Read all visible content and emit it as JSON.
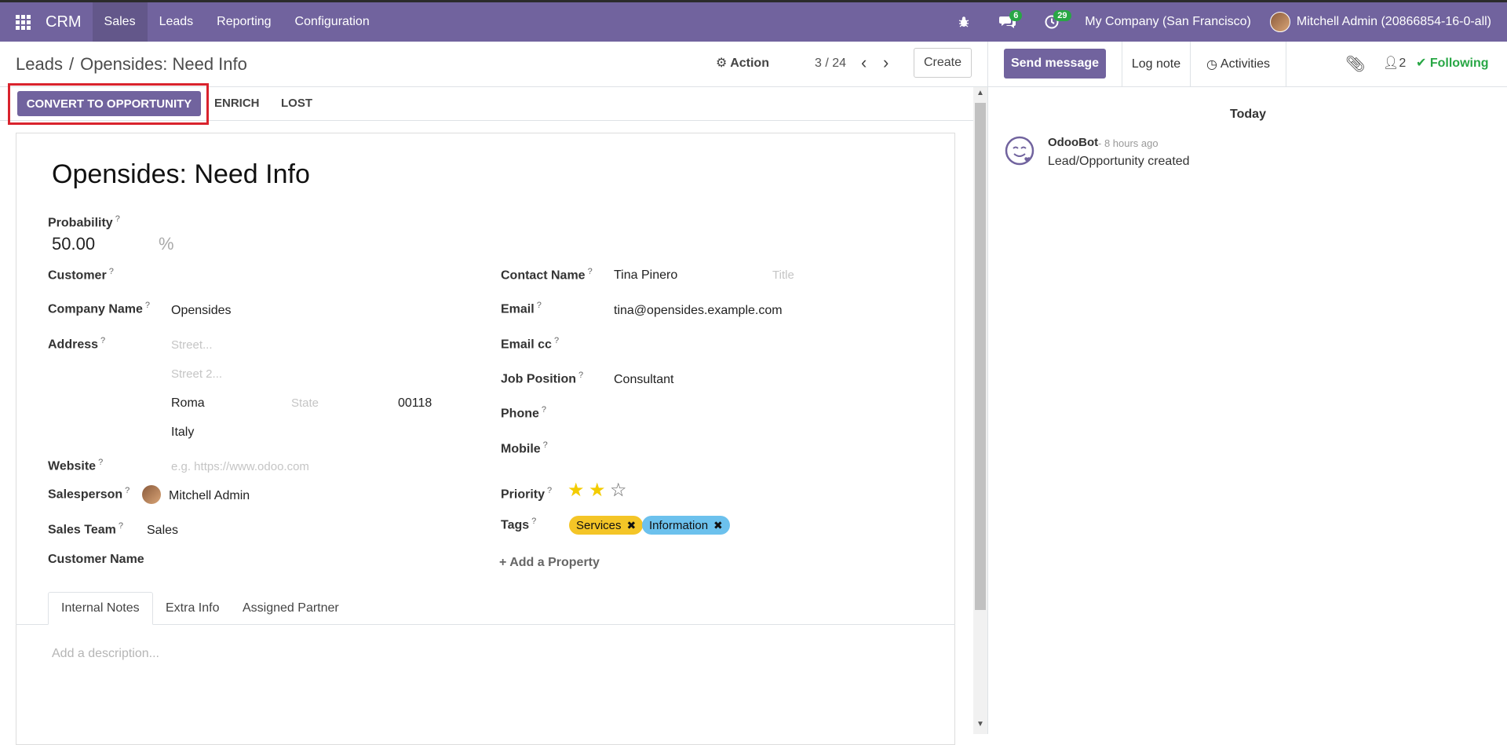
{
  "navbar": {
    "brand": "CRM",
    "menu": [
      "Sales",
      "Leads",
      "Reporting",
      "Configuration"
    ],
    "messages_count": "6",
    "activities_count": "29",
    "company": "My Company (San Francisco)",
    "user": "Mitchell Admin (20866854-16-0-all)"
  },
  "breadcrumb": {
    "parent": "Leads",
    "current": "Opensides: Need Info"
  },
  "control": {
    "action": "Action",
    "pager": "3 / 24",
    "create": "Create"
  },
  "status": {
    "convert": "CONVERT TO OPPORTUNITY",
    "enrich": "ENRICH",
    "lost": "LOST"
  },
  "form": {
    "title": "Opensides: Need Info",
    "probability_label": "Probability",
    "probability": "50.00",
    "percent": "%",
    "customer_label": "Customer",
    "company_name_label": "Company Name",
    "company_name": "Opensides",
    "address_label": "Address",
    "street_ph": "Street...",
    "street2_ph": "Street 2...",
    "city": "Roma",
    "state_ph": "State",
    "zip": "00118",
    "country": "Italy",
    "website_label": "Website",
    "website_ph": "e.g. https://www.odoo.com",
    "salesperson_label": "Salesperson",
    "salesperson": "Mitchell Admin",
    "sales_team_label": "Sales Team",
    "sales_team": "Sales",
    "customer_name_label": "Customer Name",
    "contact_name_label": "Contact Name",
    "contact_name": "Tina Pinero",
    "title_ph": "Title",
    "email_label": "Email",
    "email": "tina@opensides.example.com",
    "email_cc_label": "Email cc",
    "job_position_label": "Job Position",
    "job_position": "Consultant",
    "phone_label": "Phone",
    "mobile_label": "Mobile",
    "priority_label": "Priority",
    "priority": 2,
    "tags_label": "Tags",
    "tags": [
      {
        "name": "Services",
        "color": "#f4c527"
      },
      {
        "name": "Information",
        "color": "#6cc1ed"
      }
    ],
    "add_property": "Add a Property"
  },
  "tabs": [
    "Internal Notes",
    "Extra Info",
    "Assigned Partner"
  ],
  "description_ph": "Add a description...",
  "chatter": {
    "send": "Send message",
    "log": "Log note",
    "activities": "Activities",
    "followers": "2",
    "following": "Following",
    "date": "Today",
    "author": "OdooBot",
    "time": "- 8 hours ago",
    "body": "Lead/Opportunity created"
  },
  "colors": {
    "primary": "#71639e",
    "highlight": "#d9232d",
    "star": "#f3cc00",
    "success": "#28a745"
  }
}
